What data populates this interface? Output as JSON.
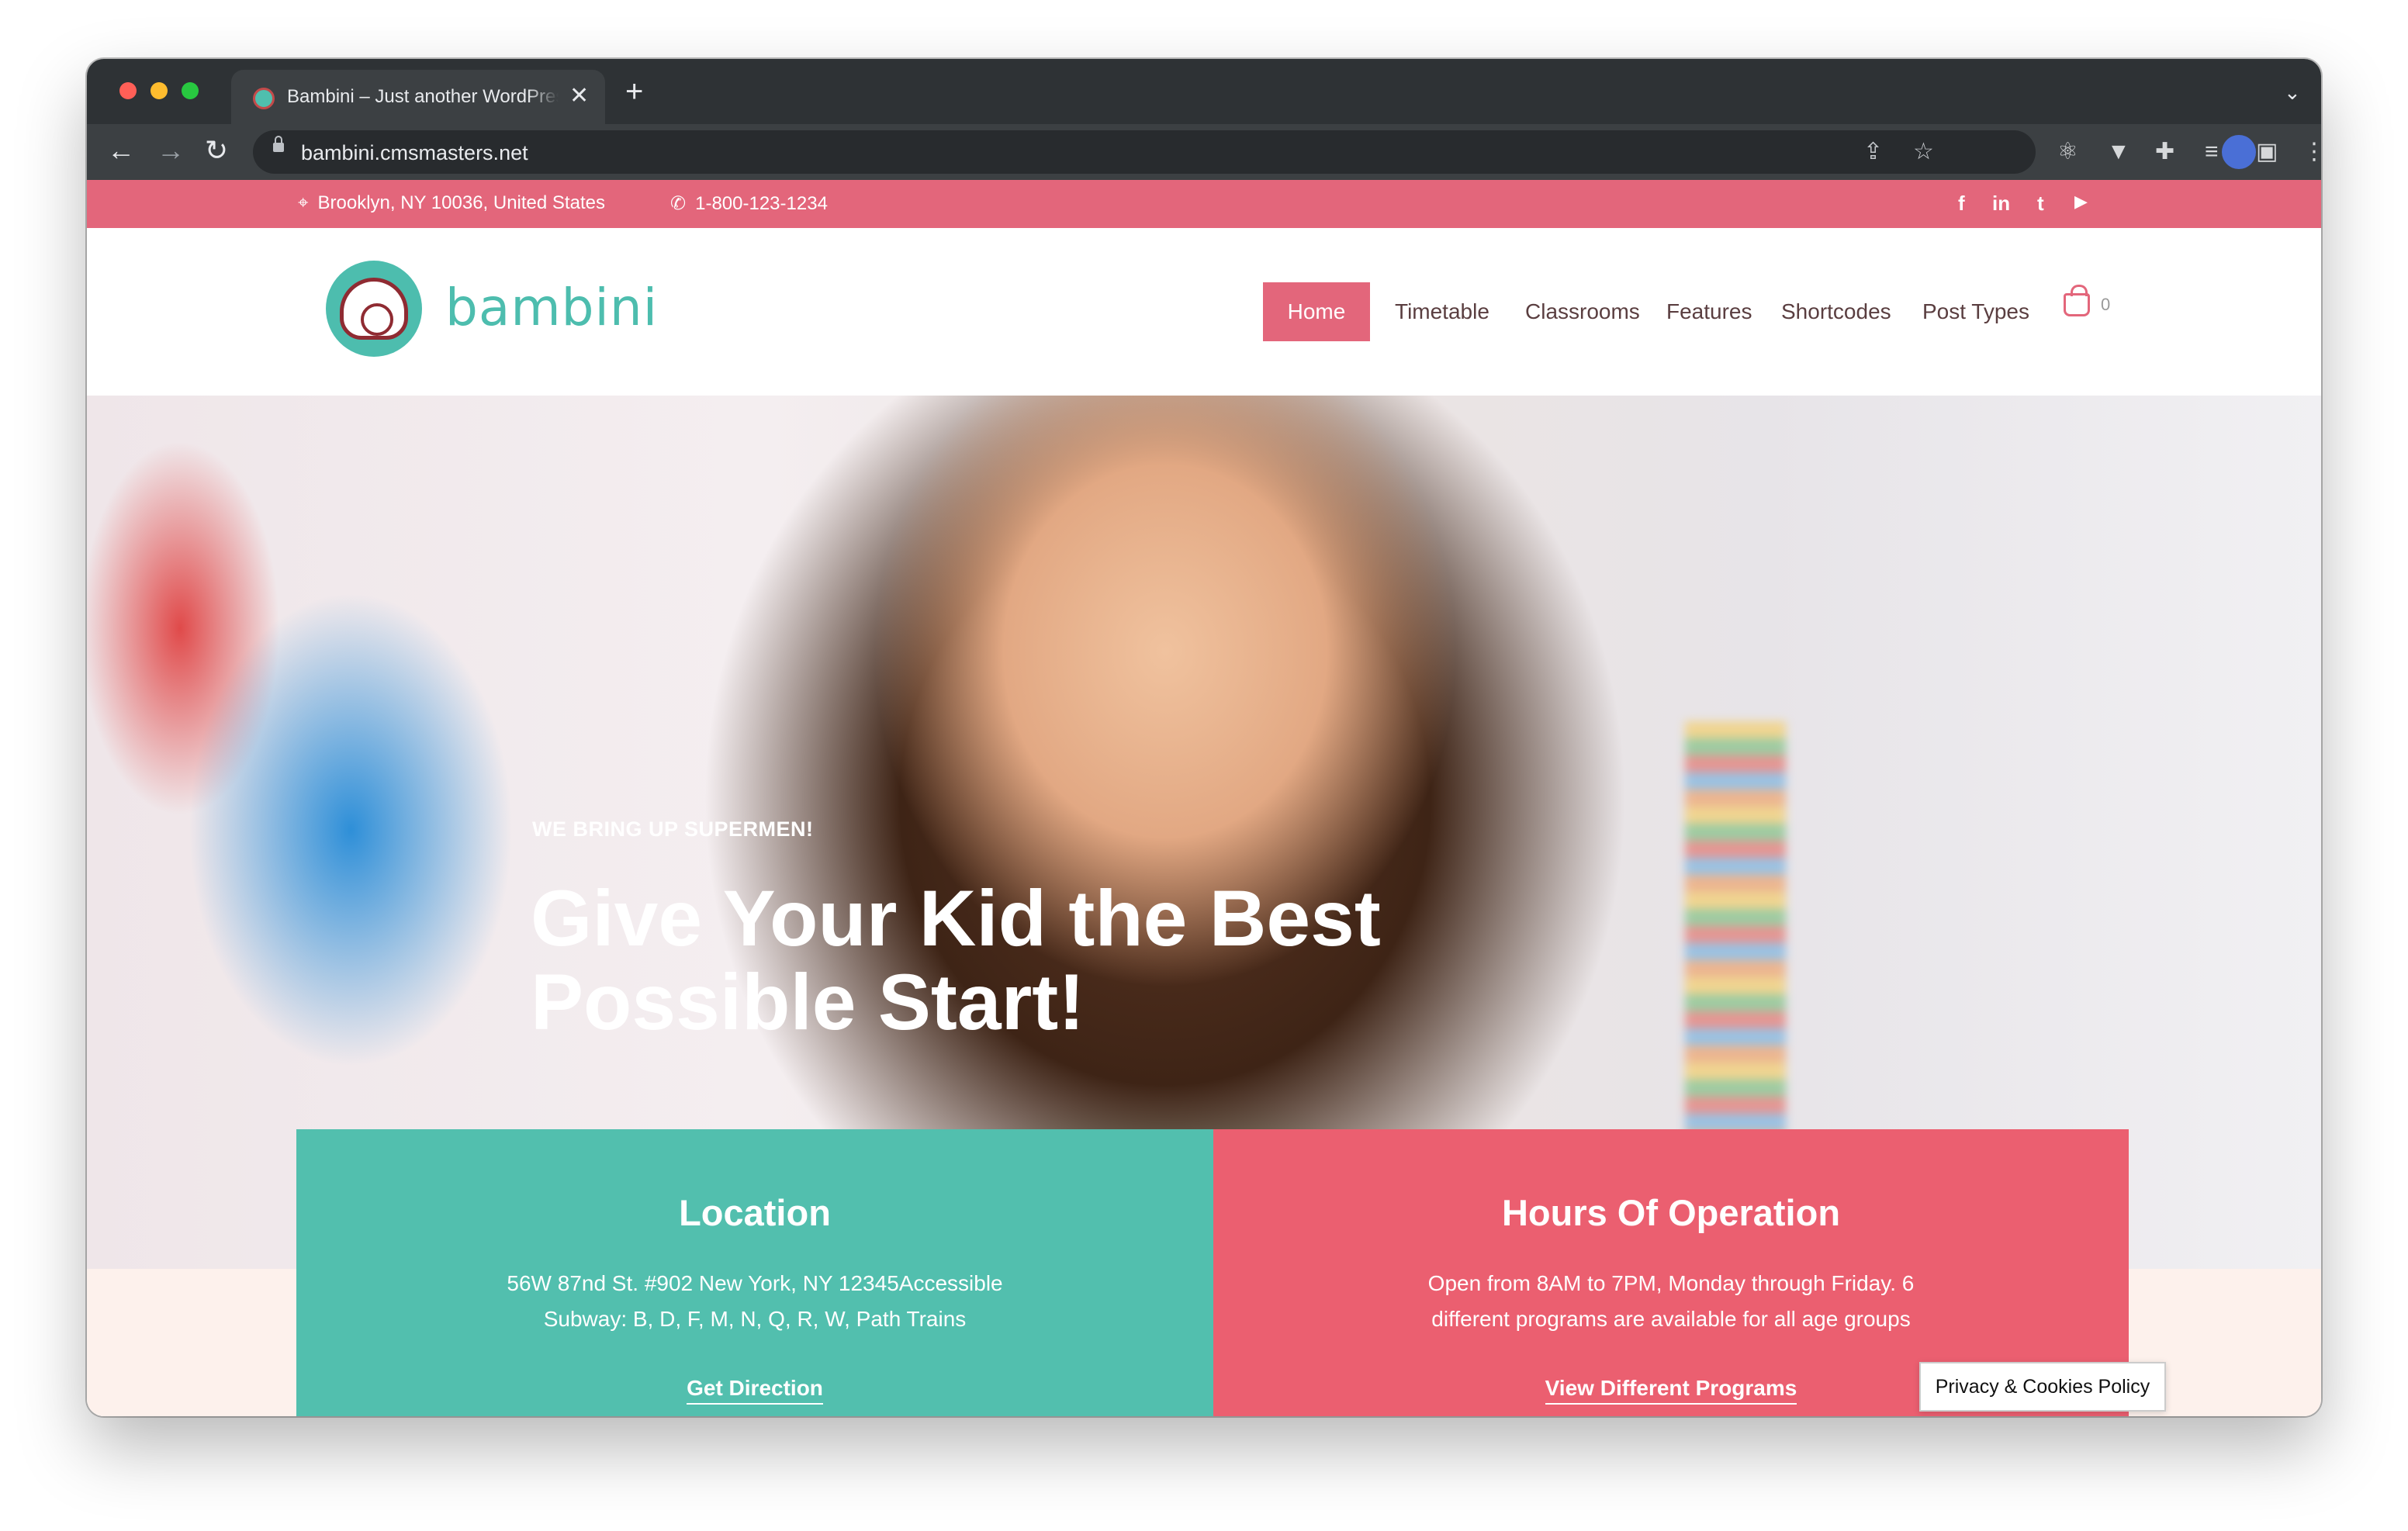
{
  "browser": {
    "tab_title": "Bambini – Just another WordPress site",
    "url": "bambini.cmsmasters.net"
  },
  "topbar": {
    "address": "Brooklyn, NY 10036, United States",
    "phone": "1-800-123-1234",
    "social": [
      "f",
      "in",
      "t",
      "▶"
    ]
  },
  "header": {
    "logo_text": "bambini",
    "nav": [
      "Home",
      "Timetable",
      "Classrooms",
      "Features",
      "Shortcodes",
      "Post Types"
    ],
    "cart_count": "0"
  },
  "hero": {
    "subtitle": "WE BRING UP SUPERMEN!",
    "title": "Give Your Kid the Best Possible Start!"
  },
  "cards": {
    "location": {
      "title": "Location",
      "text": "56W 87nd St. #902 New York, NY 12345Accessible Subway: B, D, F, M, N, Q, R, W, Path Trains",
      "link": "Get Direction",
      "color": "#52bfae"
    },
    "hours": {
      "title": "Hours Of Operation",
      "text": "Open from 8AM to 7PM, Monday through Friday. 6 different programs are available for all age groups",
      "link": "View Different Programs",
      "color": "#eb5f70"
    }
  },
  "privacy_label": "Privacy & Cookies Policy",
  "colors": {
    "brand_pink": "#e3667b",
    "brand_teal": "#4dbdae"
  }
}
